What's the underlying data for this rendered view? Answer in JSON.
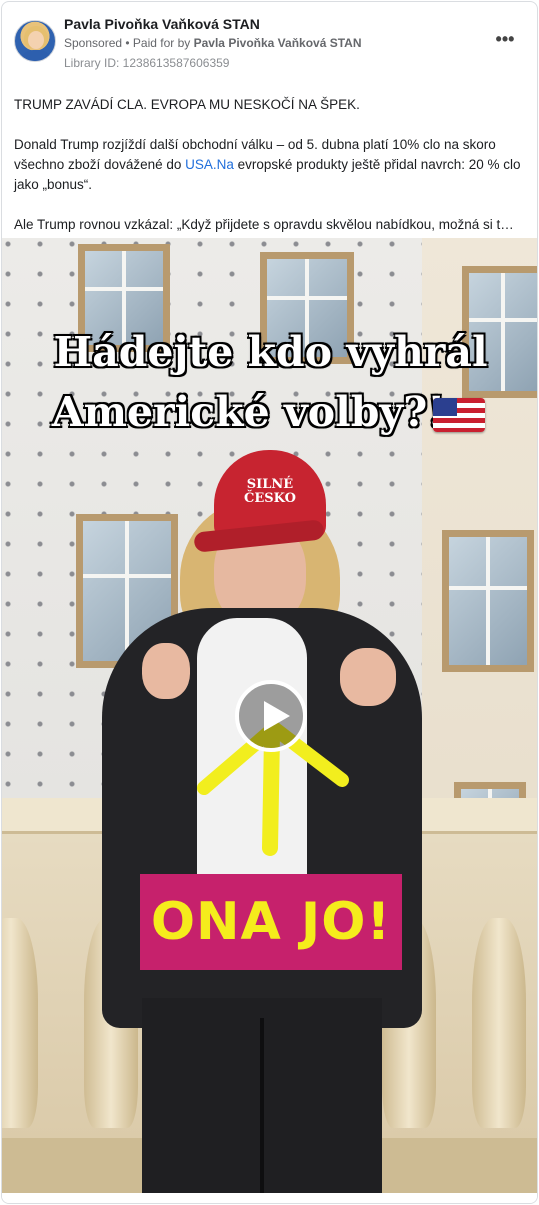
{
  "post": {
    "page_name": "Pavla Pivoňka Vaňková STAN",
    "sponsored_label": "Sponsored",
    "separator": " • ",
    "paid_prefix": "Paid for by ",
    "paid_by": "Pavla Pivoňka Vaňková STAN",
    "library_id": "Library ID: 1238613587606359",
    "more_icon": "more-horizontal-icon"
  },
  "text": {
    "headline": "TRUMP ZAVÁDÍ CLA. EVROPA MU NESKOČÍ NA ŠPEK.",
    "p2_before_link": "Donald Trump rozjíždí další obchodní válku – od 5. dubna platí 10% clo na skoro všechno zboží dovážené do ",
    "p2_link": "USA.Na",
    "p2_after_link": " evropské produkty ještě přidal navrch: 20 % clo jako „bonus“.",
    "p3": "Ale Trump rovnou vzkázal: „Když přijdete s opravdu skvělou nabídkou, možná si t…"
  },
  "video": {
    "caption_line_1": "Hádejte kdo vyhrál",
    "caption_line_2": "Americké volby?!",
    "flag_icon": "us-flag-icon",
    "cap_text_line_1": "SILNÉ",
    "cap_text_line_2": "ČESKO",
    "banner_text": "ONA JO!",
    "play_icon": "play-icon",
    "colors": {
      "banner_bg": "#c6216c",
      "banner_text": "#f5ec1c",
      "cap": "#c72430",
      "arrow": "#f2ee1e"
    }
  }
}
